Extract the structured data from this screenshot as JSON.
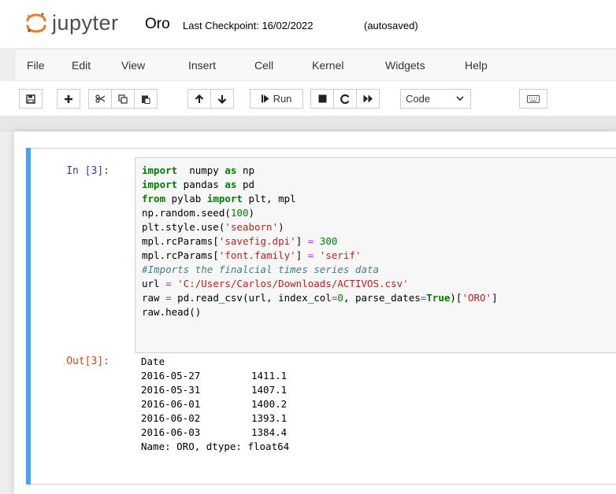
{
  "header": {
    "logo_text": "jupyter",
    "notebook_name": "Oro",
    "checkpoint": "Last Checkpoint: 16/02/2022",
    "autosave": "(autosaved)"
  },
  "menu": [
    "File",
    "Edit",
    "View",
    "Insert",
    "Cell",
    "Kernel",
    "Widgets",
    "Help"
  ],
  "toolbar": {
    "icons": [
      "save-icon",
      "plus-icon",
      "cut-icon",
      "copy-icon",
      "paste-icon",
      "arrow-up-icon",
      "arrow-down-icon",
      "step-forward-icon",
      "stop-icon",
      "restart-icon",
      "fast-forward-icon",
      "keyboard-icon"
    ],
    "run_label": "Run",
    "cell_type": "Code"
  },
  "colors": {
    "accent": "#42a5f5",
    "in_prompt": "#303f9f",
    "out_prompt": "#d84315",
    "keyword": "#008000",
    "string": "#ba2121",
    "comment": "#408080"
  },
  "cell": {
    "in_prompt": "In [3]:",
    "out_prompt": "Out[3]:",
    "code": [
      "import  numpy as np",
      "import pandas as pd",
      "from pylab import plt, mpl",
      "np.random.seed(100)",
      "plt.style.use('seaborn')",
      "mpl.rcParams['savefig.dpi'] = 300",
      "mpl.rcParams['font.family'] = 'serif'",
      "#Imports the finalcial times series data",
      "url = 'C:/Users/Carlos/Downloads/ACTIVOS.csv'",
      "raw = pd.read_csv(url, index_col=0, parse_dates=True)['ORO']",
      "raw.head()"
    ],
    "output": {
      "index_name": "Date",
      "rows": [
        {
          "date": "2016-05-27",
          "value": "1411.1"
        },
        {
          "date": "2016-05-31",
          "value": "1407.1"
        },
        {
          "date": "2016-06-01",
          "value": "1400.2"
        },
        {
          "date": "2016-06-02",
          "value": "1393.1"
        },
        {
          "date": "2016-06-03",
          "value": "1384.4"
        }
      ],
      "footer": "Name: ORO, dtype: float64"
    }
  }
}
